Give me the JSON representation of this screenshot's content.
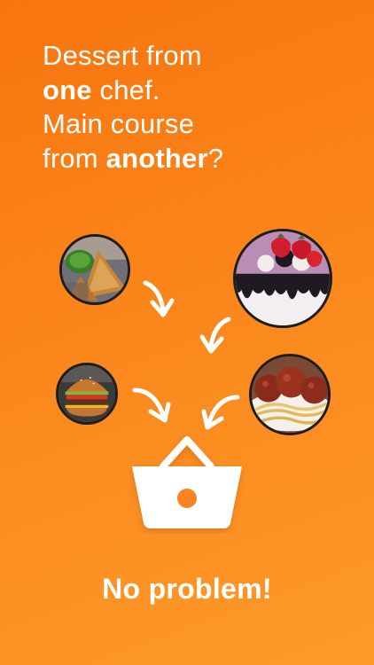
{
  "headline": {
    "line1": "Dessert from",
    "line2_bold": "one",
    "line2_rest": " chef.",
    "line3": "Main course",
    "line4_start": "from ",
    "line4_bold": "another",
    "line4_end": "?"
  },
  "foods": [
    {
      "icon": "samosa-photo"
    },
    {
      "icon": "cake-photo"
    },
    {
      "icon": "burger-photo"
    },
    {
      "icon": "spaghetti-meatballs-photo"
    }
  ],
  "basket": {
    "icon": "shopping-basket-icon"
  },
  "tagline": "No problem!",
  "colors": {
    "background_top": "#f8740f",
    "background_bottom": "#fd9a2a",
    "text": "#ffffff"
  }
}
